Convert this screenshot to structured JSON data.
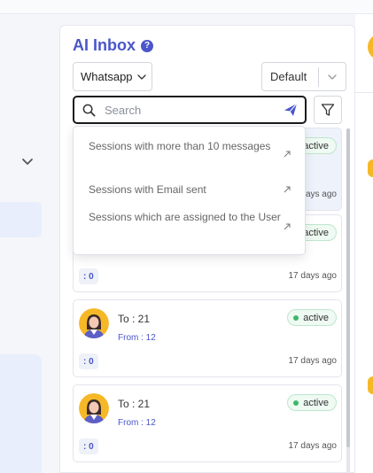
{
  "inbox": {
    "title": "AI Inbox",
    "help_icon": "?",
    "channel_select": "Whatsapp",
    "sort_select": "Default",
    "search": {
      "placeholder": "Search"
    },
    "suggestions": [
      {
        "label": "Sessions with more than 10 messages"
      },
      {
        "label": "Sessions with Email sent"
      },
      {
        "label": "Sessions which are assigned to the User"
      }
    ],
    "cards": [
      {
        "to": "",
        "from": "",
        "status": "active",
        "count": "",
        "ago": "days ago"
      },
      {
        "to": "",
        "from": "",
        "status": "active",
        "count": ": 0",
        "ago": "17 days ago"
      },
      {
        "to": "To : 21",
        "from": "From : 12",
        "status": "active",
        "count": ": 0",
        "ago": "17 days ago"
      },
      {
        "to": "To : 21",
        "from": "From : 12",
        "status": "active",
        "count": ": 0",
        "ago": "17 days ago"
      }
    ]
  },
  "colors": {
    "accent": "#4a56c9",
    "status_green": "#3db869",
    "avatar_bg": "#f6b826",
    "selected_card": "#eef2fb"
  },
  "icons": {
    "search": "search-icon",
    "send": "send-icon",
    "filter": "filter-icon",
    "chevron": "chevron-down-icon",
    "suggestion_arrow": "arrow-up-right-icon"
  }
}
